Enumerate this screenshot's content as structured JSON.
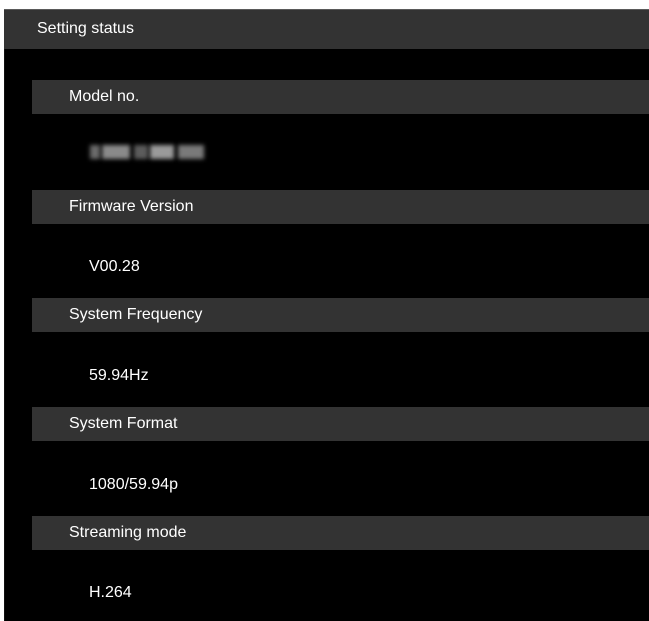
{
  "panel": {
    "title": "Setting status"
  },
  "sections": [
    {
      "label": "Model no.",
      "value": ""
    },
    {
      "label": "Firmware Version",
      "value": "V00.28"
    },
    {
      "label": "System Frequency",
      "value": "59.94Hz"
    },
    {
      "label": "System Format",
      "value": "1080/59.94p"
    },
    {
      "label": "Streaming mode",
      "value": "H.264"
    }
  ],
  "colors": {
    "background": "#000000",
    "header_bar": "#333333",
    "text": "#ffffff"
  }
}
